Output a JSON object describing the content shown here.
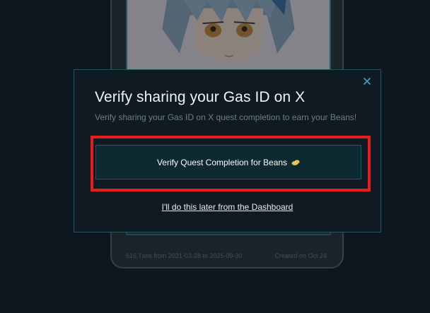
{
  "background_card": {
    "footer_left": "516 Txns from 2021-03-28 to 2025-09-30",
    "footer_right": "Created on Oct 24"
  },
  "modal": {
    "title": "Verify sharing your Gas ID on X",
    "subtitle": "Verify sharing your Gas ID on X quest completion to earn your Beans!",
    "close_icon": "close-icon",
    "verify_button_label": "Verify Quest Completion for Beans",
    "verify_button_icon": "beans-icon",
    "later_link": "I'll do this later from the Dashboard"
  },
  "colors": {
    "background": "#121a22",
    "modal_background": "#101a22",
    "modal_border": "#1f5560",
    "button_background": "#0c2a2f",
    "highlight": "#e81c1c",
    "accent": "#3d9bb3"
  }
}
